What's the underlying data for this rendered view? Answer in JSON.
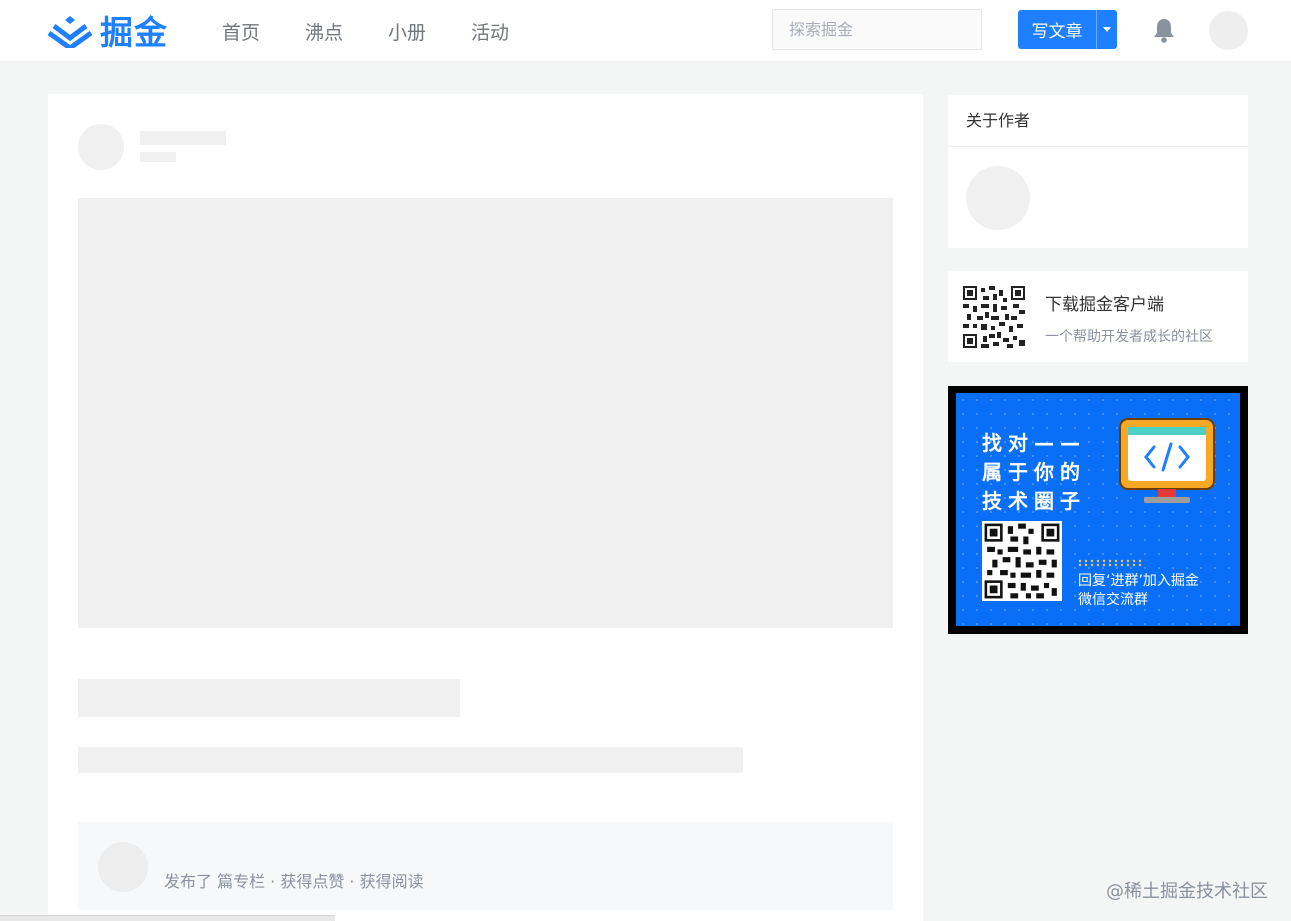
{
  "header": {
    "logo_text": "掘金",
    "nav": [
      "首页",
      "沸点",
      "小册",
      "活动"
    ],
    "search_placeholder": "探索掘金",
    "write_label": "写文章",
    "brand_color": "#1e80ff"
  },
  "article": {
    "author_stats": "发布了 篇专栏 · 获得点赞 · 获得阅读"
  },
  "sidebar": {
    "about_title": "关于作者",
    "download": {
      "title": "下载掘金客户端",
      "subtitle": "一个帮助开发者成长的社区"
    },
    "banner": {
      "lines": [
        "找对——",
        "属于你的",
        "技术圈子"
      ],
      "caption_lines": [
        "回复‘进群’加入掘金",
        "微信交流群"
      ],
      "background_color": "#0a6ff7"
    }
  },
  "watermark": "@稀土掘金技术社区"
}
